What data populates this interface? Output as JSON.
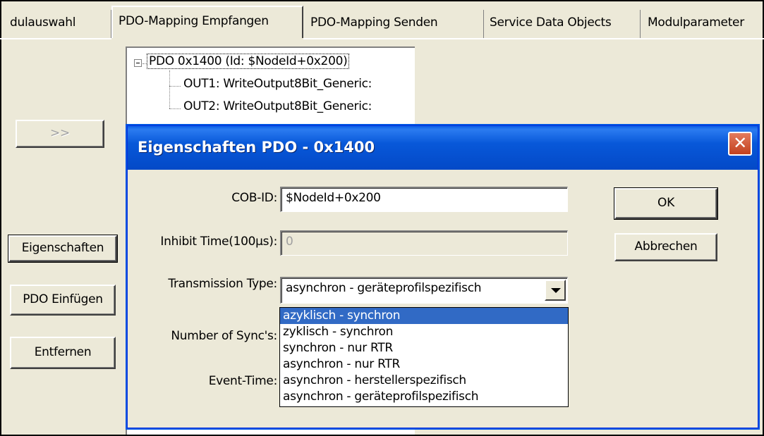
{
  "tabs": [
    {
      "label": "dulauswahl",
      "active": false
    },
    {
      "label": "PDO-Mapping Empfangen",
      "active": true
    },
    {
      "label": "PDO-Mapping Senden",
      "active": false
    },
    {
      "label": "Service Data Objects",
      "active": false
    },
    {
      "label": "Modulparameter",
      "active": false
    }
  ],
  "left_buttons": {
    "arrow": ">>",
    "properties": "Eigenschaften",
    "insert_pdo": "PDO Einfügen",
    "remove": "Entfernen"
  },
  "tree": {
    "root": "PDO 0x1400 (Id: $NodeId+0x200)",
    "children": [
      "OUT1: WriteOutput8Bit_Generic:",
      "OUT2: WriteOutput8Bit_Generic:"
    ]
  },
  "dialog": {
    "title": "Eigenschaften PDO - 0x1400",
    "close_glyph": "✕",
    "ok_label": "OK",
    "cancel_label": "Abbrechen",
    "cob_id_label": "COB-ID:",
    "cob_id_value": "$NodeId+0x200",
    "inhibit_label": "Inhibit Time(100µs):",
    "inhibit_value": "0",
    "transmission_label": "Transmission Type:",
    "transmission_value": "asynchron - geräteprofilspezifisch",
    "sync_label": "Number of Sync's:",
    "event_label": "Event-Time:",
    "transmission_options": [
      "azyklisch - synchron",
      "zyklisch - synchron",
      "synchron - nur RTR",
      "asynchron - nur RTR",
      "asynchron - herstellerspezifisch",
      "asynchron - geräteprofilspezifisch"
    ],
    "highlighted_option": "azyklisch - synchron"
  },
  "colors": {
    "title_bar": "#0858d9",
    "selection": "#316ac5",
    "window_bg": "#ece9d8",
    "close_button": "#c2401e"
  },
  "icons": {
    "close": "close-icon",
    "dropdown_arrow": "chevron-down-icon",
    "tree_collapse": "minus-box-icon"
  }
}
